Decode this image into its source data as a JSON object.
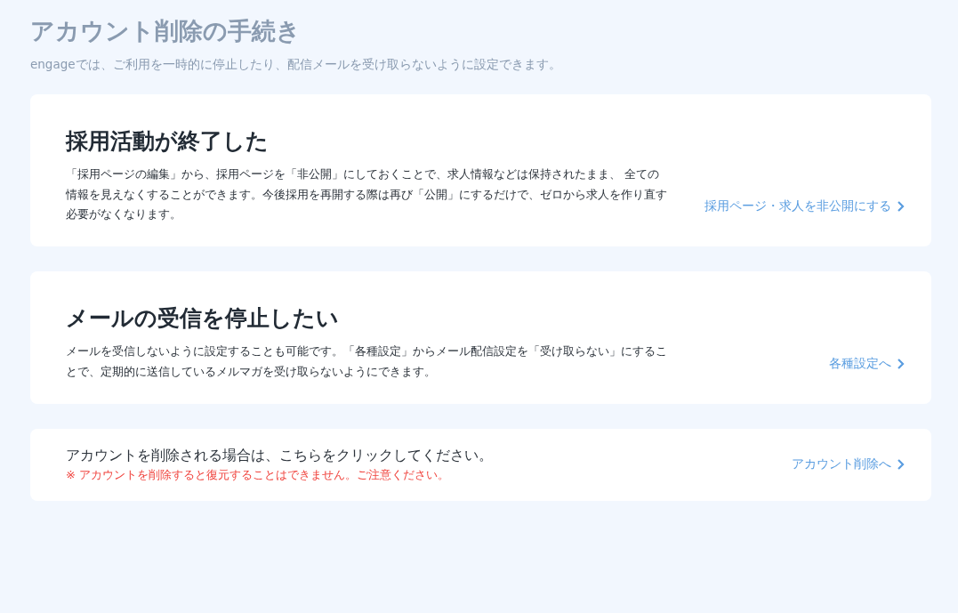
{
  "page": {
    "title": "アカウント削除の手続き",
    "subtitle": "engageでは、ご利用を一時的に停止したり、配信メールを受け取らないように設定できます。"
  },
  "cards": [
    {
      "heading": "採用活動が終了した",
      "body": "「採用ページの編集」から、採用ページを「非公開」にしておくことで、求人情報などは保持されたまま、 全ての情報を見えなくすることができます。今後採用を再開する際は再び「公開」にするだけで、ゼロから求人を作り直す必要がなくなります。",
      "link": "採用ページ・求人を非公開にする"
    },
    {
      "heading": "メールの受信を停止したい",
      "body": "メールを受信しないように設定することも可能です。「各種設定」からメール配信設定を「受け取らない」にすることで、定期的に送信しているメルマガを受け取らないようにできます。",
      "link": "各種設定へ"
    }
  ],
  "delete": {
    "text": "アカウントを削除される場合は、こちらをクリックしてください。",
    "warning": "※ アカウントを削除すると復元することはできません。ご注意ください。",
    "link": "アカウント削除へ"
  }
}
